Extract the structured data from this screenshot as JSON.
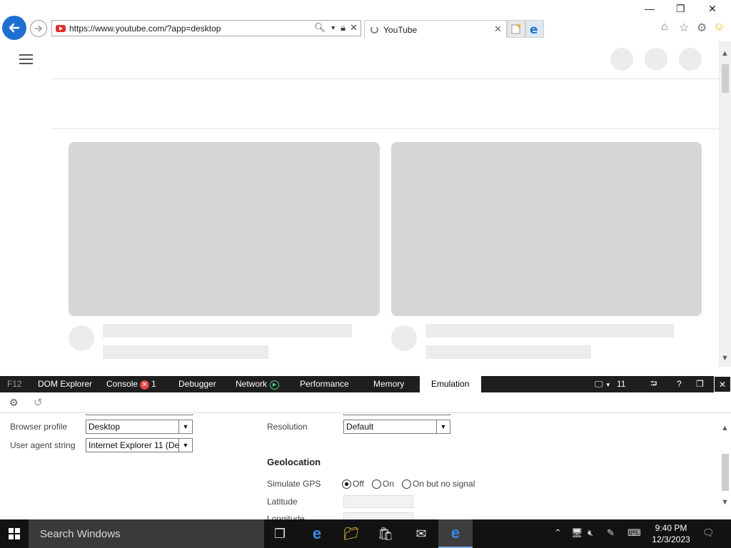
{
  "browser": {
    "url": "https://www.youtube.com/?app=desktop",
    "tab_title": "YouTube"
  },
  "devtools": {
    "f12_label": "F12",
    "tabs": [
      {
        "label": "DOM Explorer"
      },
      {
        "label": "Console",
        "badge": "1"
      },
      {
        "label": "Debugger"
      },
      {
        "label": "Network"
      },
      {
        "label": "Performance"
      },
      {
        "label": "Memory"
      },
      {
        "label": "Emulation",
        "active": true
      }
    ],
    "doc_mode": "11",
    "emulation": {
      "browser_profile_label": "Browser profile",
      "browser_profile_value": "Desktop",
      "user_agent_label": "User agent string",
      "user_agent_value": "Internet Explorer 11 (De",
      "resolution_label": "Resolution",
      "resolution_value": "Default",
      "geolocation_heading": "Geolocation",
      "simulate_gps_label": "Simulate GPS",
      "gps_options": [
        "Off",
        "On",
        "On but no signal"
      ],
      "gps_selected": "Off",
      "latitude_label": "Latitude",
      "longitude_label": "Longitude"
    }
  },
  "taskbar": {
    "search_placeholder": "Search Windows",
    "time": "9:40 PM",
    "date": "12/3/2023"
  },
  "colors": {
    "accent": "#1f6fd1",
    "skeleton_dark": "#d6d6d6",
    "skeleton_light": "#ececec",
    "devtools_bar": "#1e1e1e",
    "taskbar": "#121212"
  }
}
